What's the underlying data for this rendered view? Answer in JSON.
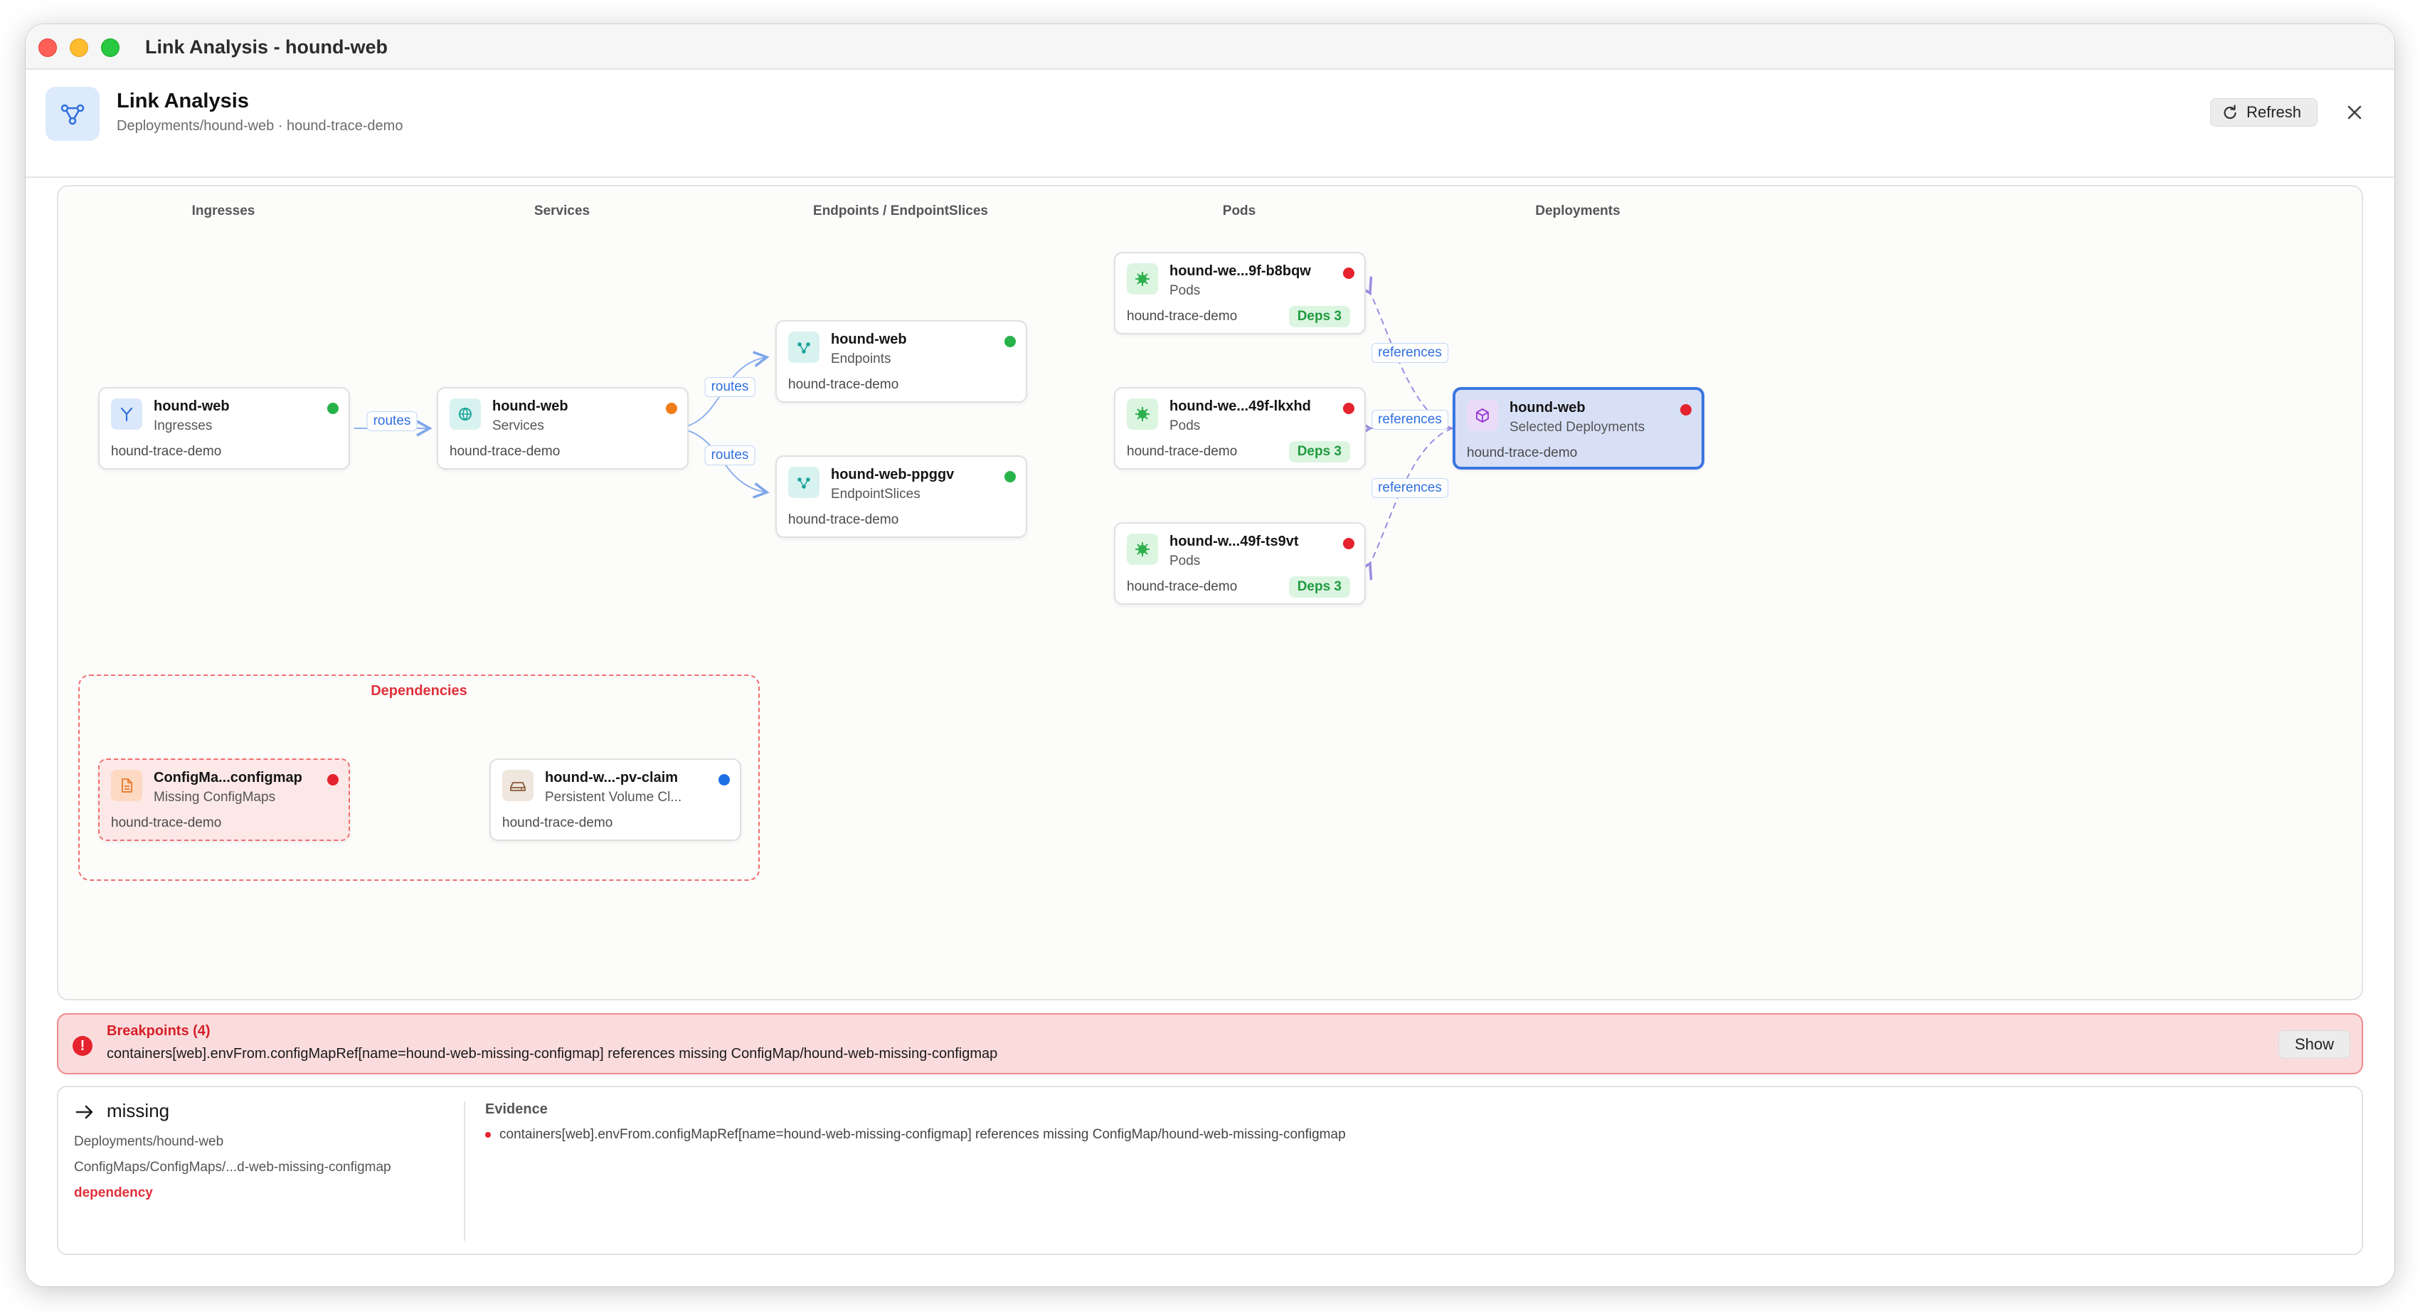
{
  "window": {
    "title": "Link Analysis - hound-web"
  },
  "header": {
    "title": "Link Analysis",
    "subtitle": "Deployments/hound-web · hound-trace-demo",
    "refresh_label": "Refresh",
    "icon": "link-graph-icon"
  },
  "columns": {
    "ingresses": "Ingresses",
    "services": "Services",
    "endpoints": "Endpoints / EndpointSlices",
    "pods": "Pods",
    "deployments": "Deployments"
  },
  "nodes": {
    "ingress": {
      "name": "hound-web",
      "kind": "Ingresses",
      "namespace": "hound-trace-demo",
      "status_color": "#28b34a",
      "icon": "ingress-icon"
    },
    "service": {
      "name": "hound-web",
      "kind": "Services",
      "namespace": "hound-trace-demo",
      "status_color": "#f07d1a",
      "icon": "service-icon"
    },
    "endpoints": {
      "name": "hound-web",
      "kind": "Endpoints",
      "namespace": "hound-trace-demo",
      "status_color": "#28b34a",
      "icon": "endpoints-icon"
    },
    "endpointslice": {
      "name": "hound-web-ppggv",
      "kind": "EndpointSlices",
      "namespace": "hound-trace-demo",
      "status_color": "#28b34a",
      "icon": "endpointslice-icon"
    },
    "pod1": {
      "name": "hound-we...9f-b8bqw",
      "kind": "Pods",
      "namespace": "hound-trace-demo",
      "badge": "Deps 3",
      "status_color": "#e5232e",
      "icon": "pod-icon"
    },
    "pod2": {
      "name": "hound-we...49f-lkxhd",
      "kind": "Pods",
      "namespace": "hound-trace-demo",
      "badge": "Deps 3",
      "status_color": "#e5232e",
      "icon": "pod-icon"
    },
    "pod3": {
      "name": "hound-w...49f-ts9vt",
      "kind": "Pods",
      "namespace": "hound-trace-demo",
      "badge": "Deps 3",
      "status_color": "#e5232e",
      "icon": "pod-icon"
    },
    "deployment": {
      "name": "hound-web",
      "kind": "Selected Deployments",
      "namespace": "hound-trace-demo",
      "status_color": "#e5232e",
      "icon": "deployment-icon"
    },
    "configmap": {
      "name": "ConfigMa...configmap",
      "kind": "Missing ConfigMaps",
      "namespace": "hound-trace-demo",
      "status_color": "#e5232e",
      "icon": "configmap-file-icon"
    },
    "pvc": {
      "name": "hound-w...-pv-claim",
      "kind": "Persistent Volume Cl...",
      "namespace": "hound-trace-demo",
      "status_color": "#1f6fe5",
      "icon": "volume-claim-icon"
    }
  },
  "edges": {
    "routes": "routes",
    "references": "references"
  },
  "dependencies": {
    "title": "Dependencies"
  },
  "breakpoints": {
    "title": "Breakpoints (4)",
    "text": "containers[web].envFrom.configMapRef[name=hound-web-missing-configmap] references missing ConfigMap/hound-web-missing-configmap",
    "show_label": "Show"
  },
  "detail": {
    "title": "missing",
    "line1": "Deployments/hound-web",
    "line2": "ConfigMaps/ConfigMaps/...d-web-missing-configmap",
    "line3": "dependency",
    "evidence_title": "Evidence",
    "evidence_item": "containers[web].envFrom.configMapRef[name=hound-web-missing-configmap] references missing ConfigMap/hound-web-missing-configmap"
  }
}
